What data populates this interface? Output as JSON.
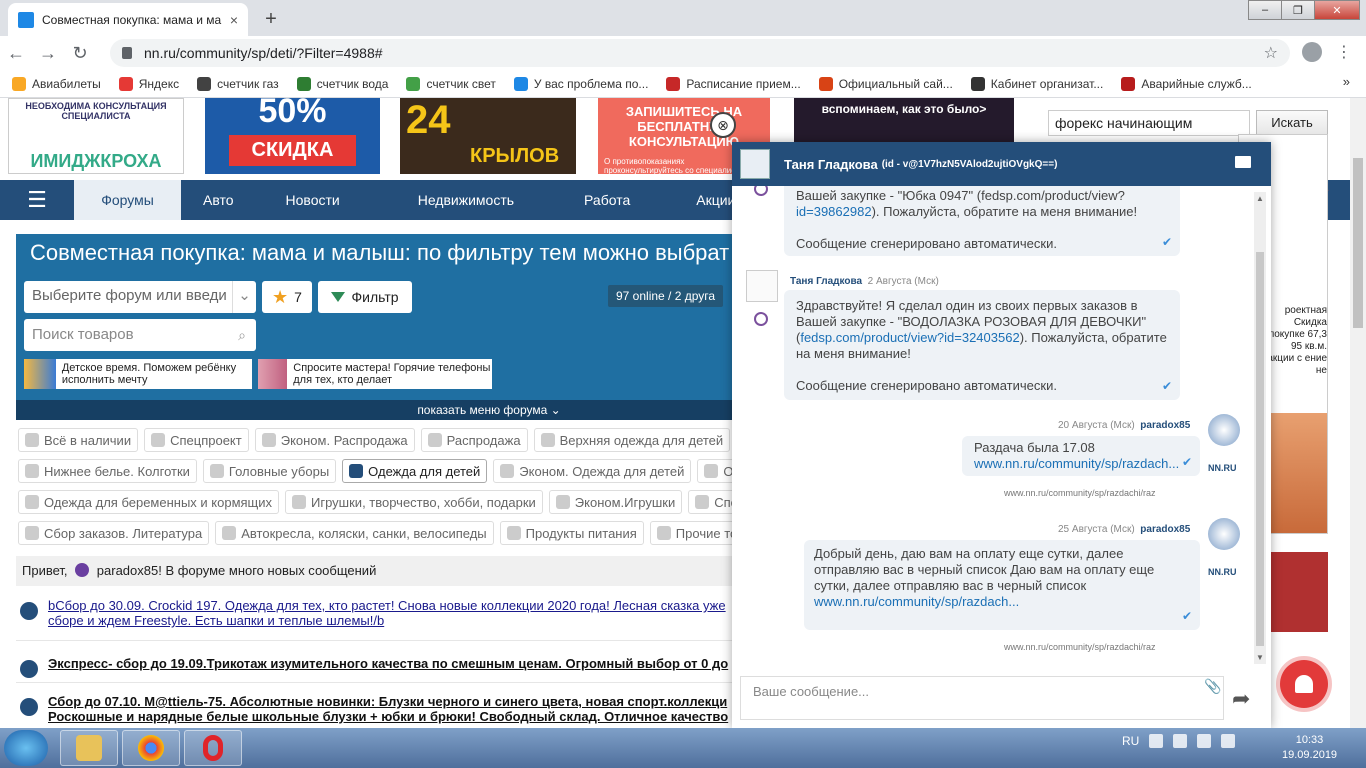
{
  "browser": {
    "tab_title": "Совместная покупка: мама и ма",
    "close_tab": "×",
    "new_tab": "+",
    "url": "nn.ru/community/sp/deti/?Filter=4988#",
    "bookmarks": [
      {
        "label": "Авиабилеты",
        "color": "#f9a825"
      },
      {
        "label": "Яндекс",
        "color": "#e53935"
      },
      {
        "label": "счетчик газ",
        "color": "#424242"
      },
      {
        "label": "счетчик вода",
        "color": "#2e7d32"
      },
      {
        "label": "счетчик свет",
        "color": "#43a047"
      },
      {
        "label": "У вас проблема по...",
        "color": "#1e88e5"
      },
      {
        "label": "Расписание прием...",
        "color": "#c62828"
      },
      {
        "label": "Официальный сай...",
        "color": "#d84315"
      },
      {
        "label": "Кабинет организат...",
        "color": "#333333"
      },
      {
        "label": "Аварийные служб...",
        "color": "#b71c1c"
      }
    ],
    "bookmarks_more": "»"
  },
  "banners": {
    "b1_top": "НЕОБХОДИМА КОНСУЛЬТАЦИЯ СПЕЦИАЛИСТА",
    "b1_brand": "ИМИДЖКРОХА",
    "b2_big": "50%",
    "b2_sub": "СКИДКА",
    "b3_num": "24",
    "b3_name": "КРЫЛОВ",
    "b4_title": "ЗАПИШИТЕСЬ НА БЕСПЛАТНУЮ КОНСУЛЬТАЦИЮ",
    "b4_small": "О противопоказаниях проконсультируйтесь со специалистом",
    "b5_title": "вспоминаем, как это было>"
  },
  "site_search": {
    "value": "форекс начинающим",
    "button": "Искать"
  },
  "nav": {
    "items": [
      "Форумы",
      "Авто",
      "Новости",
      "Недвижимость",
      "Работа",
      "Акции и с"
    ],
    "active": "Форумы"
  },
  "forum": {
    "title": "Совместная покупка: мама и малыш: по фильтру тем можно выбрат",
    "forum_select_placeholder": "Выберите форум или введи",
    "favorites_count": "7",
    "filter_label": "Фильтр",
    "online": "97 online / 2 друга",
    "product_search_placeholder": "Поиск товаров",
    "promo1": "Детское время. Поможем ребёнку исполнить мечту",
    "promo2": "Спросите мастера! Горячие телефоны для тех, кто делает",
    "show_menu": "показать меню форума"
  },
  "categories": [
    [
      "Всё в наличии",
      "Спецпроект",
      "Эконом. Распродажа",
      "Распродажа",
      "Верхняя одежда для детей"
    ],
    [
      "Нижнее белье. Колготки",
      "Головные уборы",
      "Одежда для детей",
      "Эконом. Одежда для детей",
      "Об"
    ],
    [
      "Одежда для беременных и кормящих",
      "Игрушки, творчество, хобби, подарки",
      "Эконом.Игрушки",
      "Спо"
    ],
    [
      "Сбор заказов. Литература",
      "Автокресла, коляски, санки, велосипеды",
      "Продукты питания",
      "Прочие то"
    ]
  ],
  "active_category": "Одежда для детей",
  "greeting": {
    "pre": "Привет,",
    "user": "paradox85",
    "post": "! В форуме много новых сообщений"
  },
  "topics": [
    {
      "text": "bСбор до 30.09. Crockid 197. Одежда для тех, кто растет! Снова новые коллекции 2020 года! Лесная сказка уже сборе и ждем Freestyle. Есть шапки и теплые шлемы!/b",
      "bold": false
    },
    {
      "text": "Экспресс- сбор до 19.09.Трикотаж изумительного качества по смешным ценам. Огромный выбор от 0 до",
      "bold": true
    },
    {
      "text": "Сбор до 07.10. M@ttiель-75. Абсолютные новинки: Блузки черного и синего цвета, новая спорт.коллекци Роскошные и нарядные белые школьные блузки + юбки и брюки! Свободный склад. Отличное качество",
      "bold": true
    }
  ],
  "right_ad": {
    "text": "роектная Скидка покупке 67,3 95 кв.м. акции с ение не"
  },
  "chat": {
    "name": "Таня Гладкова",
    "id": "(id - v@1V7hzN5VAlod2ujtiOVgkQ==)",
    "messages": [
      {
        "line1": "Вашей закупке - \"Юбка 0947\" (fedsp.com/product/view?",
        "link": "id=39862982",
        "tail": "). Пожалуйста, обратите на меня внимание!",
        "auto": "Сообщение сгенерировано автоматически."
      },
      {
        "author": "Таня Гладкова",
        "date": "2 Августа (Мск)",
        "line1": "Здравствуйте! Я сделал один из своих первых заказов в Вашей закупке - \"ВОДОЛАЗКА РОЗОВАЯ ДЛЯ ДЕВОЧКИ\"",
        "link": "fedsp.com/product/view?id=32403562",
        "tail": "). Пожалуйста, обратите на меня внимание!",
        "auto": "Сообщение сгенерировано автоматически."
      },
      {
        "author": "paradox85",
        "date": "20 Августа (Мск)",
        "text": "Раздача была 17.08",
        "link": "www.nn.ru/community/sp/razdach...",
        "url_under": "www.nn.ru/community/sp/razdachi/raz"
      },
      {
        "author": "paradox85",
        "date": "25 Августа (Мск)",
        "text": "Добрый день, даю вам на оплату еще сутки, далее отправляю вас в черный список Даю вам на оплату еще сутки, далее отправляю вас в черный список",
        "link": "www.nn.ru/community/sp/razdach...",
        "url_under": "www.nn.ru/community/sp/razdachi/raz"
      }
    ],
    "nn_logo": "NN.RU",
    "input_placeholder": "Ваше сообщение...",
    "close": "⊗"
  },
  "taskbar": {
    "lang": "RU",
    "time": "10:33",
    "date": "19.09.2019"
  }
}
